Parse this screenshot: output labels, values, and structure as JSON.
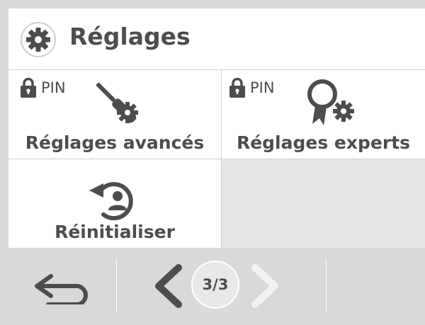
{
  "header": {
    "title": "Réglages",
    "icon": "gear-icon"
  },
  "tiles": [
    {
      "label": "Réglages avancés",
      "pin_label": "PIN",
      "icon": "tools-gear-icon",
      "locked": true
    },
    {
      "label": "Réglages experts",
      "pin_label": "PIN",
      "icon": "expert-award-gear-icon",
      "locked": true
    },
    {
      "label": "Réinitialiser",
      "icon": "reset-user-icon",
      "locked": false
    }
  ],
  "footer": {
    "back_icon": "back-arrow-icon",
    "pager": {
      "text": "3/3",
      "current": 3,
      "total": 3
    },
    "prev_icon": "chevron-left-icon",
    "next_icon": "chevron-right-icon"
  },
  "colors": {
    "text": "#4d4d4d",
    "footer_bg": "#d9d9d9",
    "disabled": "#f2f2f2"
  }
}
